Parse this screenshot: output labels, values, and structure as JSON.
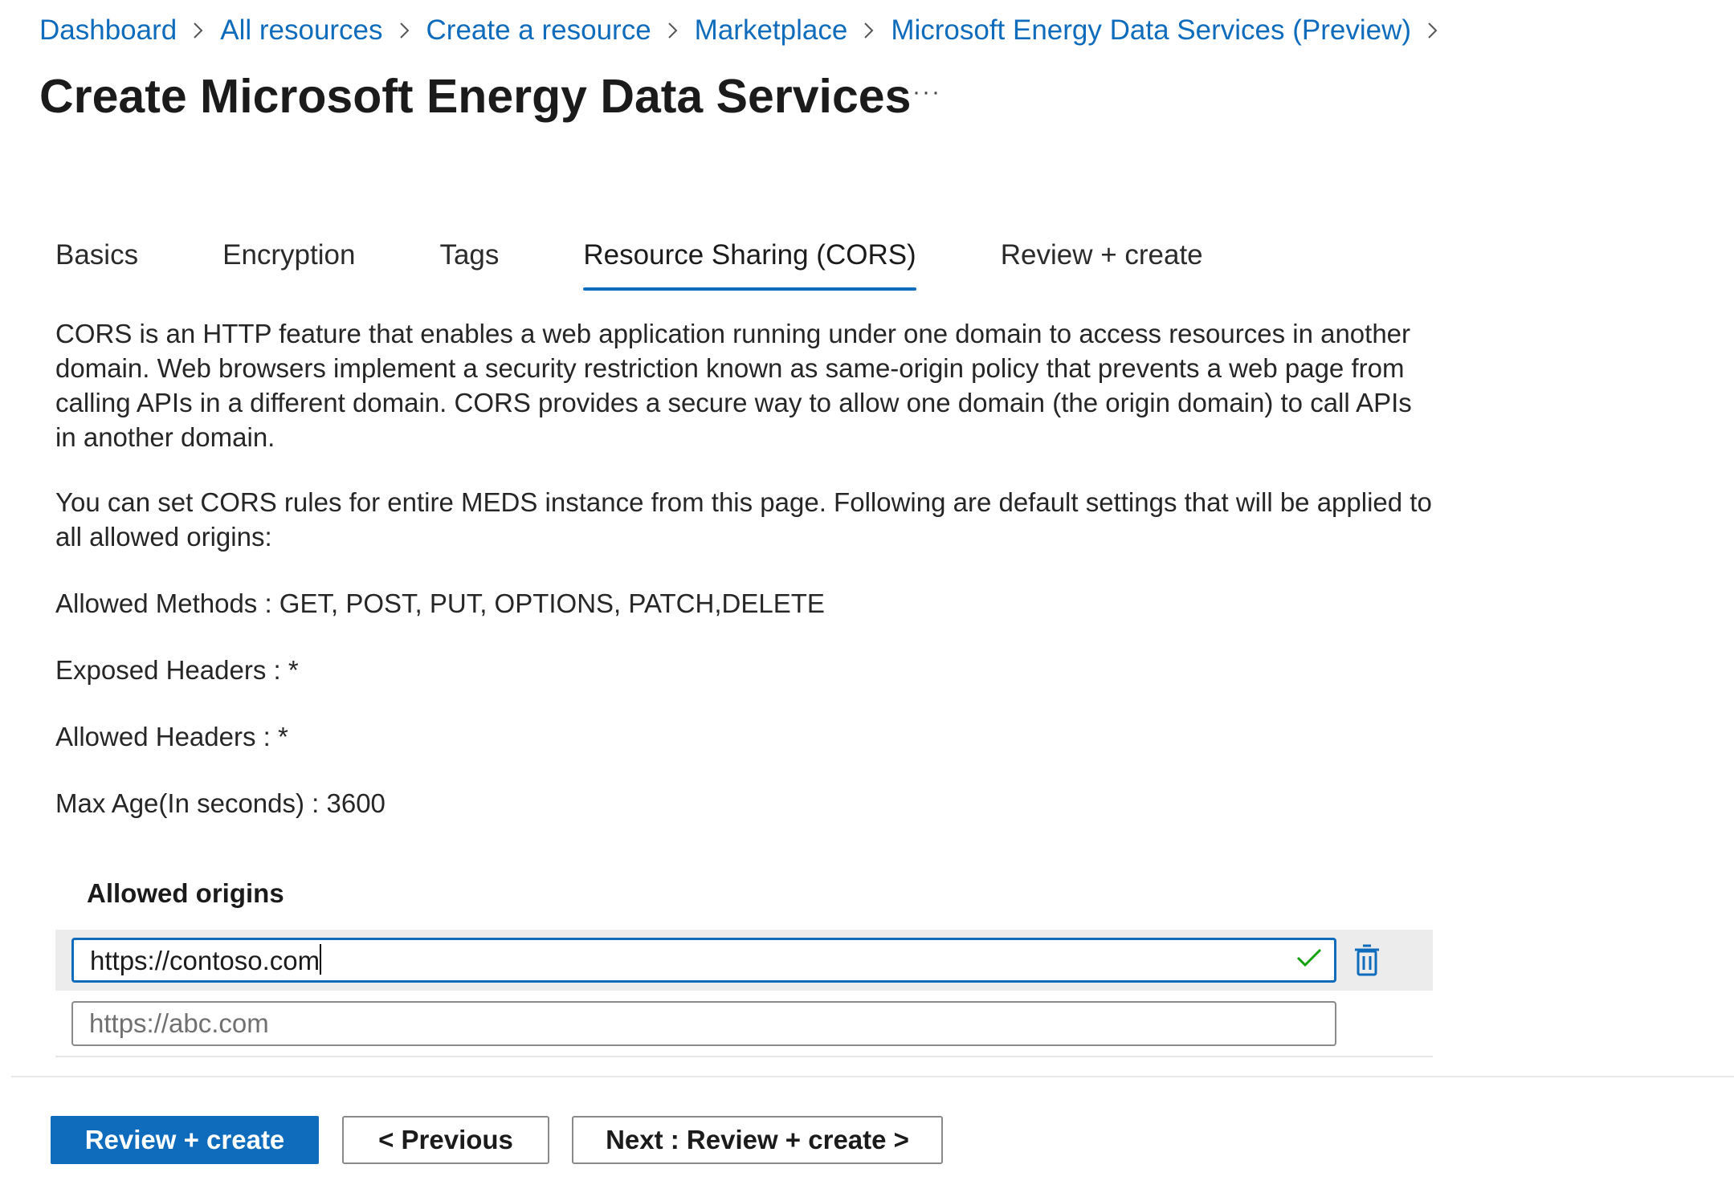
{
  "breadcrumb": [
    "Dashboard",
    "All resources",
    "Create a resource",
    "Marketplace",
    "Microsoft Energy Data Services (Preview)"
  ],
  "title": "Create Microsoft Energy Data Services",
  "more_label": "···",
  "tabs": [
    "Basics",
    "Encryption",
    "Tags",
    "Resource Sharing (CORS)",
    "Review + create"
  ],
  "active_tab": "Resource Sharing (CORS)",
  "intro": "CORS is an HTTP feature that enables a web application running under one domain to access resources in another domain. Web browsers implement a security restriction known as same-origin policy that prevents a web page from calling APIs in a different domain. CORS provides a secure way to allow one domain (the origin domain) to call APIs in another domain.",
  "settings_intro": "You can set CORS rules for entire MEDS instance from this page. Following are default settings that will be applied to all allowed origins:",
  "settings": {
    "allowed_methods": "Allowed Methods : GET, POST, PUT, OPTIONS, PATCH,DELETE",
    "exposed_headers": "Exposed Headers : *",
    "allowed_headers": "Allowed Headers : *",
    "max_age": "Max Age(In seconds) : 3600"
  },
  "origins": {
    "label": "Allowed origins",
    "value": "https://contoso.com",
    "placeholder": "https://abc.com"
  },
  "buttons": {
    "review_create": "Review + create",
    "previous": "< Previous",
    "next": "Next : Review + create >"
  },
  "colors": {
    "accent": "#0f6cbd",
    "success": "#13a10e"
  }
}
